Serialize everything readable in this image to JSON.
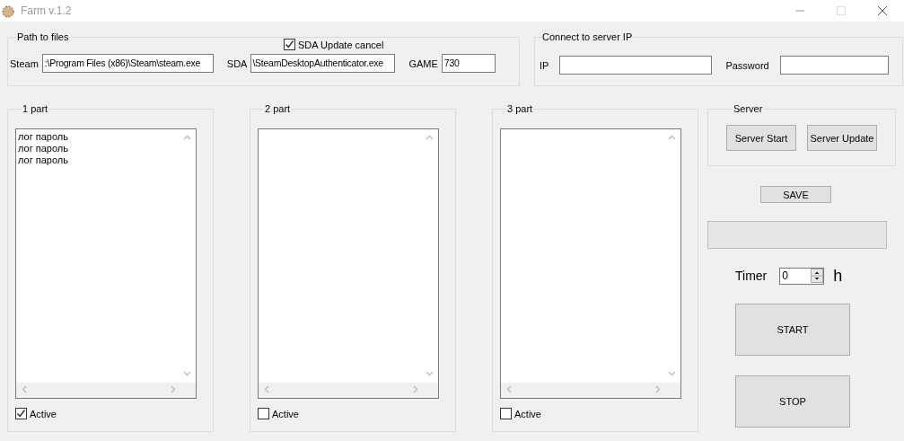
{
  "window": {
    "title": "Farm v.1.2"
  },
  "path_group": {
    "title": "Path to files",
    "sda_update_cancel": {
      "label": "SDA Update cancel",
      "checked": true
    },
    "fields": [
      {
        "label": "Steam",
        "value": ":\\Program Files (x86)\\Steam\\steam.exe"
      },
      {
        "label": "SDA",
        "value": "\\SteamDesktopAuthenticator.exe"
      },
      {
        "label": "GAME",
        "value": "730"
      }
    ]
  },
  "server_ip_group": {
    "title": "Connect to server IP",
    "fields": [
      {
        "label": "IP"
      },
      {
        "label": "Password"
      }
    ]
  },
  "parts": [
    {
      "title": "1 part",
      "lines": [
        "лог пароль",
        "лог пароль",
        "лог пароль"
      ],
      "active": {
        "label": "Active",
        "checked": true
      }
    },
    {
      "title": "2 part",
      "active": {
        "label": "Active",
        "checked": false
      }
    },
    {
      "title": "3 part",
      "active": {
        "label": "Active",
        "checked": false
      }
    }
  ],
  "server_group": {
    "title": "Server",
    "buttons": [
      "Server Start",
      "Server Update"
    ]
  },
  "save_button": "SAVE",
  "timer": {
    "label": "Timer",
    "value": "0",
    "unit": "h"
  },
  "start_button": "START",
  "stop_button": "STOP"
}
